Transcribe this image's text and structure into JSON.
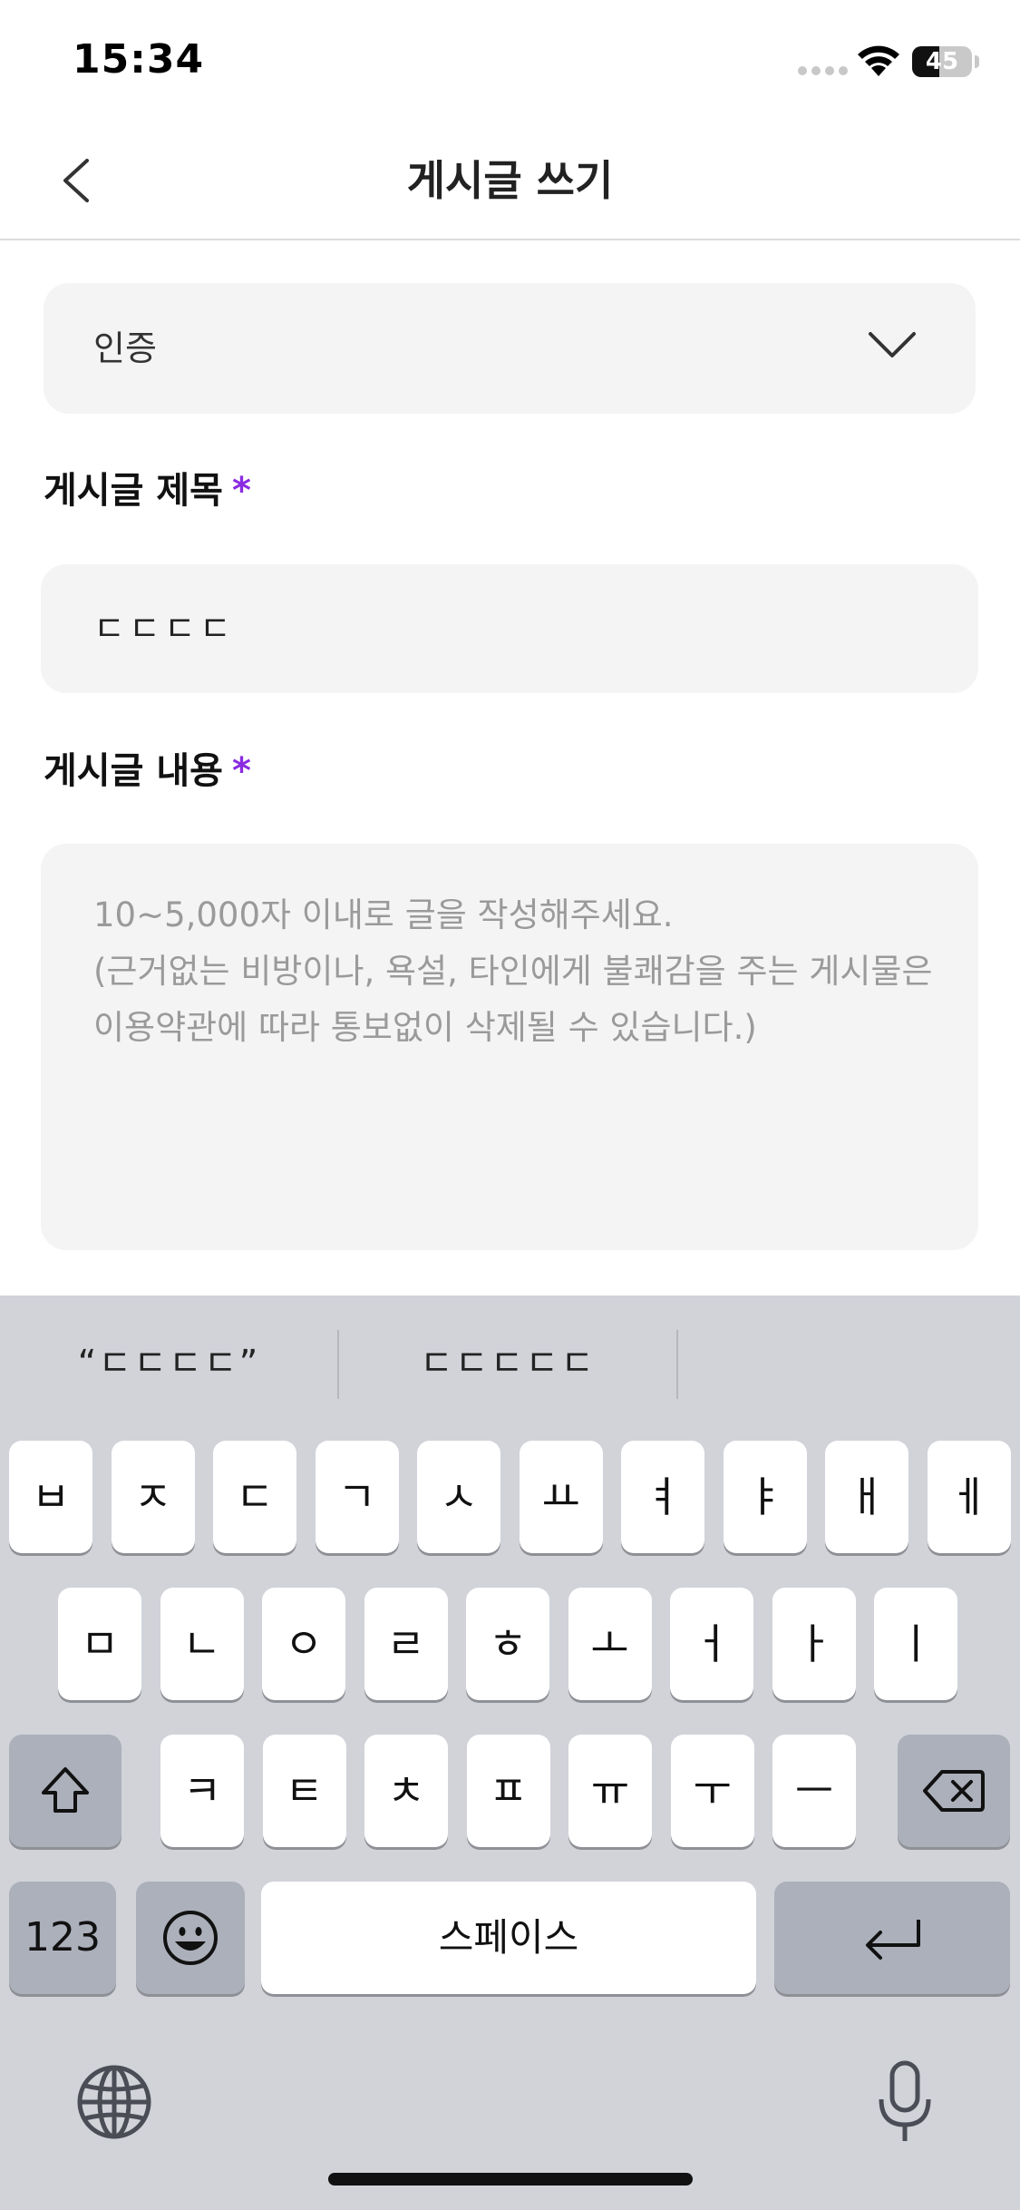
{
  "status_bar": {
    "time": "15:34",
    "battery_level": "45"
  },
  "header": {
    "title": "게시글 쓰기"
  },
  "form": {
    "category": {
      "selected": "인증"
    },
    "title_section": {
      "label": "게시글 제목",
      "required_mark": "*"
    },
    "title_input": {
      "value": "ㄷㄷㄷㄷ"
    },
    "content_section": {
      "label": "게시글 내용",
      "required_mark": "*"
    },
    "content_input": {
      "placeholder": "10~5,000자 이내로 글을 작성해주세요.\n(근거없는 비방이나, 욕설, 타인에게 불쾌감을 주는 게시물은 이용약관에 따라 통보없이 삭제될 수 있습니다.)"
    }
  },
  "keyboard": {
    "suggestions": [
      "“ㄷㄷㄷㄷ”",
      "ㄷㄷㄷㄷㄷ"
    ],
    "row1": [
      "ㅂ",
      "ㅈ",
      "ㄷ",
      "ㄱ",
      "ㅅ",
      "ㅛ",
      "ㅕ",
      "ㅑ",
      "ㅐ",
      "ㅔ"
    ],
    "row2": [
      "ㅁ",
      "ㄴ",
      "ㅇ",
      "ㄹ",
      "ㅎ",
      "ㅗ",
      "ㅓ",
      "ㅏ",
      "ㅣ"
    ],
    "row3": [
      "ㅋ",
      "ㅌ",
      "ㅊ",
      "ㅍ",
      "ㅠ",
      "ㅜ",
      "ㅡ"
    ],
    "numbers_label": "123",
    "space_label": "스페이스"
  }
}
